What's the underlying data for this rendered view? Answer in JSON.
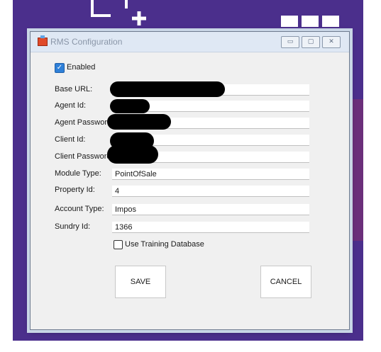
{
  "window": {
    "title": "RMS Configuration",
    "min_glyph": "▭",
    "max_glyph": "▢",
    "close_glyph": "✕"
  },
  "enabled": {
    "label": "Enabled",
    "checked": true
  },
  "fields": {
    "base_url": {
      "label": "Base URL:",
      "value": ""
    },
    "agent_id": {
      "label": "Agent Id:",
      "value": ""
    },
    "agent_password": {
      "label": "Agent Password",
      "value": ""
    },
    "client_id": {
      "label": "Client Id:",
      "value": ""
    },
    "client_password": {
      "label": "Client Password",
      "value": ""
    },
    "module_type": {
      "label": "Module Type:",
      "value": "PointOfSale"
    },
    "property_id": {
      "label": "Property Id:",
      "value": "4"
    },
    "account_type": {
      "label": "Account Type:",
      "value": "Impos"
    },
    "sundry_id": {
      "label": "Sundry Id:",
      "value": "1366"
    }
  },
  "training": {
    "label": "Use Training Database",
    "checked": false
  },
  "buttons": {
    "save": "SAVE",
    "cancel": "CANCEL"
  },
  "icons": {
    "background_add": "add-window-icon",
    "background_grid": "grid-apps-icon",
    "app": "app-icon",
    "check": "✓"
  },
  "colors": {
    "accent": "#2f80d8",
    "desktop": "#472a86",
    "dialog": "#f0f0f0"
  }
}
